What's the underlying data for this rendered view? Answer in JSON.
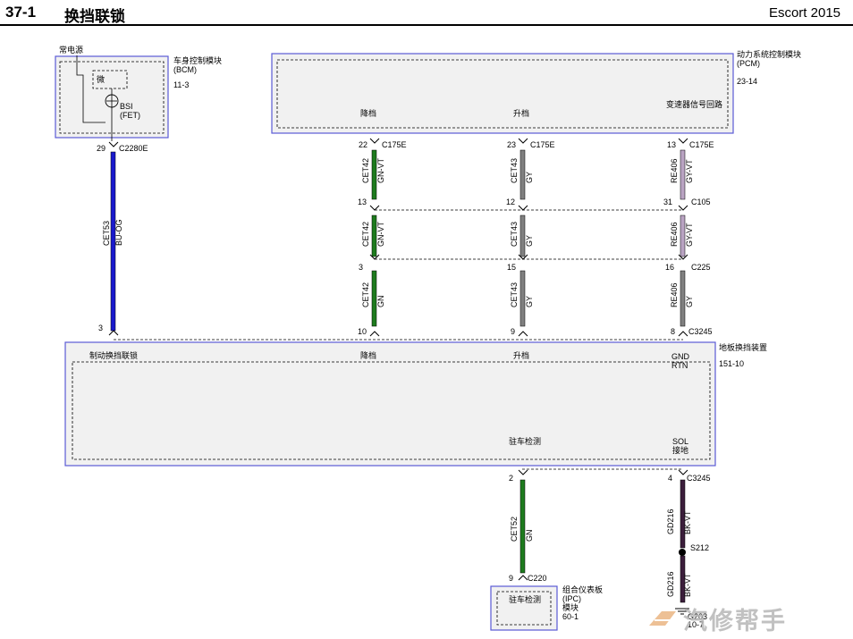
{
  "header": {
    "page_number": "37-1",
    "title": "换挡联锁",
    "model": "Escort 2015"
  },
  "modules": {
    "bcm": {
      "name": "车身控制模块",
      "abbr": "(BCM)",
      "ref": "11-3",
      "power_label": "常电源",
      "micro_label": "微",
      "bsi_label": "BSI",
      "fet_label": "(FET)"
    },
    "pcm": {
      "name": "动力系统控制模块",
      "abbr": "(PCM)",
      "ref": "23-14",
      "pin_down": "降档",
      "pin_up": "升档",
      "pin_return": "变速器信号回路"
    },
    "shifter": {
      "name": "地板换挡装置",
      "ref": "151-10",
      "pin_brake": "制动换挡联锁",
      "pin_down": "降档",
      "pin_up": "升档",
      "pin_gnd": "GND",
      "pin_rtn": "RTN",
      "pin_park": "驻车检测",
      "pin_sol": "SOL",
      "pin_sol_gnd": "接地"
    },
    "ipc": {
      "name": "组合仪表板",
      "abbr": "(IPC)",
      "name2": "模块",
      "ref": "60-1",
      "pin_park": "驻车检测"
    }
  },
  "connectors": {
    "c2280e": "C2280E",
    "c175e": "C175E",
    "c105": "C105",
    "c225": "C225",
    "c3245": "C3245",
    "c220": "C220",
    "s212": "S212",
    "g203": "G203",
    "g203_ref": "10-7"
  },
  "pins": {
    "bcm_out": "29",
    "shifter_brake": "3",
    "down_pcm": "22",
    "down_c105": "13",
    "down_c225": "3",
    "down_c3245": "10",
    "up_pcm": "23",
    "up_c105": "12",
    "up_c225": "15",
    "up_c3245": "9",
    "ret_pcm": "13",
    "ret_c105": "31",
    "ret_c225": "16",
    "ret_c3245": "8",
    "park_c3245": "2",
    "park_c220": "9",
    "sol_c3245": "4"
  },
  "circuits": {
    "cet53": "CET53",
    "bu_og": "BU-OG",
    "cet42": "CET42",
    "gn_vt": "GN-VT",
    "gn": "GN",
    "cet43": "CET43",
    "gy": "GY",
    "re406": "RE406",
    "gy_vt": "GY-VT",
    "cet52": "CET52",
    "gd216": "GD216",
    "bk_vt": "BK-VT"
  },
  "wire_colors": {
    "blue": "#1a1acc",
    "green": "#1e7b1e",
    "gray": "#808080",
    "gray_violet": "#b9a3c2",
    "black_violet": "#3b1e3b",
    "box_border": "#5b5bd6",
    "box_fill": "#f1f1f1"
  },
  "watermark": {
    "text": "汽修帮手"
  }
}
